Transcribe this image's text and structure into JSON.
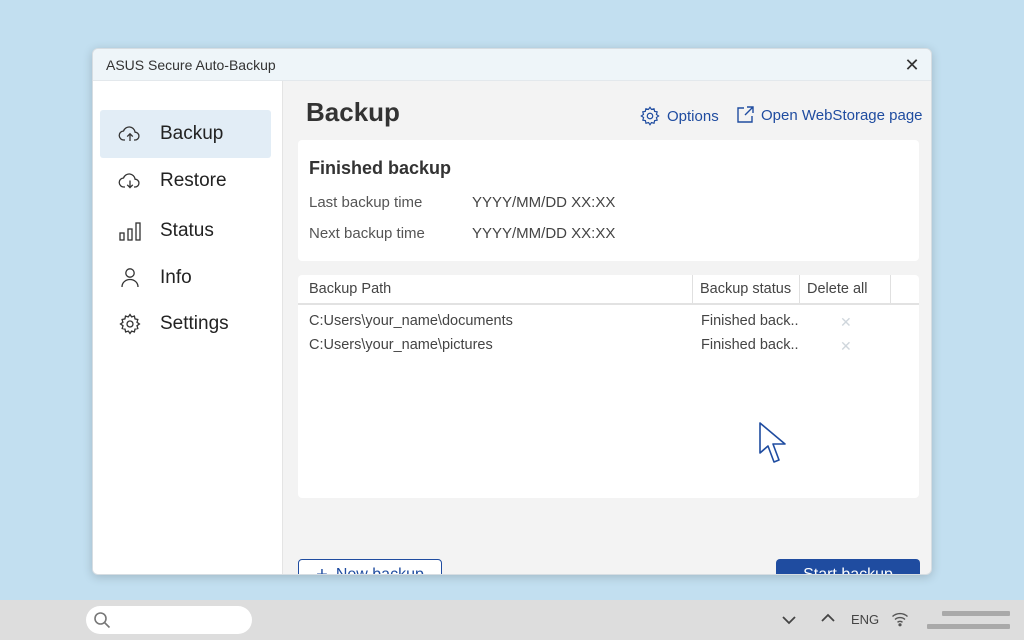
{
  "window": {
    "title": "ASUS Secure Auto-Backup"
  },
  "sidebar": {
    "items": [
      {
        "label": "Backup",
        "icon": "cloud-upload-icon",
        "active": true
      },
      {
        "label": "Restore",
        "icon": "cloud-download-icon"
      },
      {
        "label": "Status",
        "icon": "bar-chart-icon"
      },
      {
        "label": "Info",
        "icon": "user-icon"
      },
      {
        "label": "Settings",
        "icon": "gear-icon"
      }
    ]
  },
  "main": {
    "title": "Backup",
    "options_label": "Options",
    "webstorage_label": "Open WebStorage page",
    "status_card": {
      "heading": "Finished backup",
      "last_label": "Last  backup time",
      "last_value": "YYYY/MM/DD  XX:XX",
      "next_label": "Next backup time",
      "next_value": "YYYY/MM/DD  XX:XX"
    },
    "table": {
      "headers": [
        "Backup Path",
        "Backup status",
        "Delete all"
      ],
      "rows": [
        {
          "path": "C:Users\\your_name\\documents",
          "status": "Finished back.."
        },
        {
          "path": "C:Users\\your_name\\pictures",
          "status": "Finished back.."
        }
      ]
    },
    "new_backup_label": "New backup",
    "start_backup_label": "Start backup"
  },
  "taskbar": {
    "language": "ENG"
  },
  "colors": {
    "accent": "#1f4ca0",
    "background": "#c2dff0",
    "active_nav": "#e2edf6"
  }
}
